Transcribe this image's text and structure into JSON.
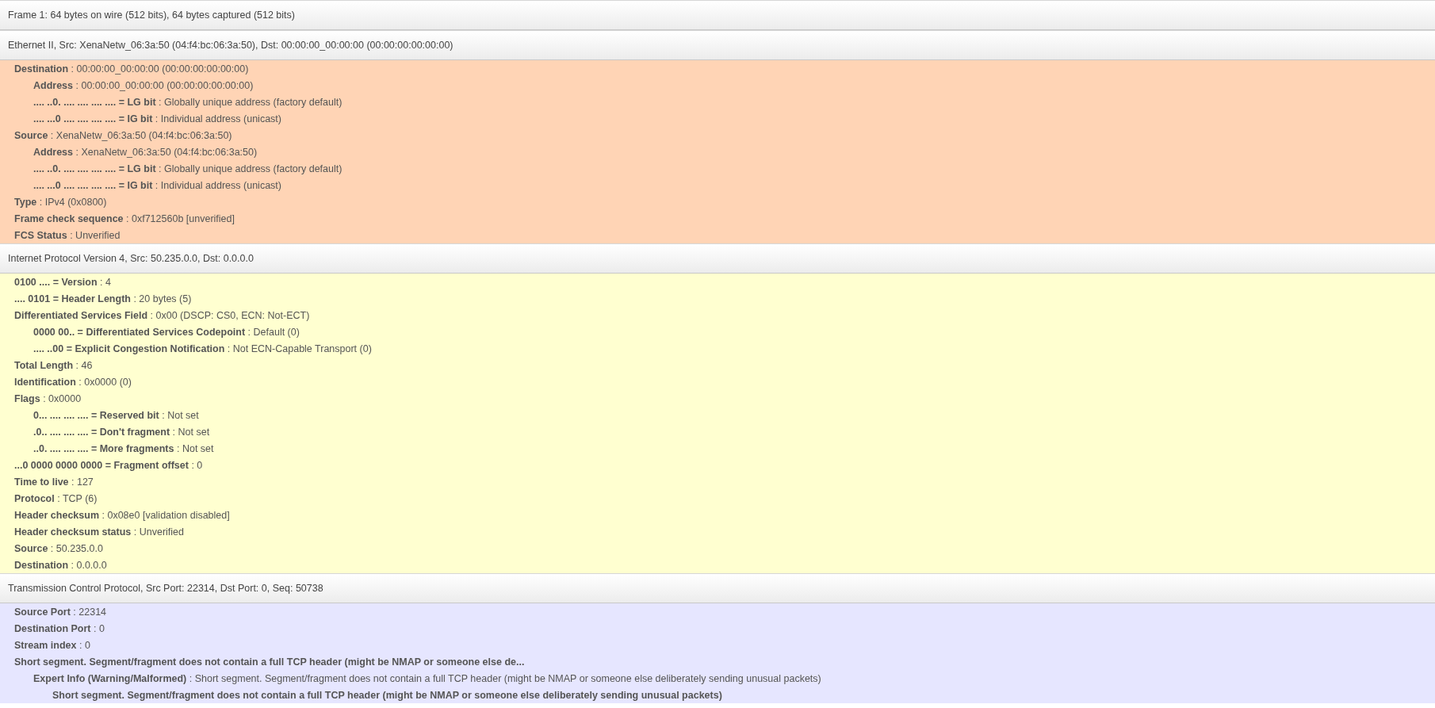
{
  "sections": [
    {
      "title": "Frame 1: 64 bytes on wire (512 bits), 64 bytes captured (512 bits)"
    },
    {
      "title": "Ethernet II, Src: XenaNetw_06:3a:50 (04:f4:bc:06:3a:50), Dst: 00:00:00_00:00:00 (00:00:00:00:00:00)",
      "color": "#ffd4b5",
      "fields": [
        {
          "kind": "field",
          "text": "**Destination** : 00:00:00_00:00:00 (00:00:00:00:00:00)",
          "children": [
            {
              "kind": "field",
              "text": "**Address** : 00:00:00_00:00:00 (00:00:00:00:00:00)"
            },
            {
              "kind": "field",
              "text": "**.... ..0. .... .... .... .... = LG bit** : Globally unique address (factory default)"
            },
            {
              "kind": "field",
              "text": "**.... ...0 .... .... .... .... = IG bit** : Individual address (unicast)"
            }
          ]
        },
        {
          "kind": "field",
          "text": "**Source** : XenaNetw_06:3a:50 (04:f4:bc:06:3a:50)",
          "children": [
            {
              "kind": "field",
              "text": "**Address** : XenaNetw_06:3a:50 (04:f4:bc:06:3a:50)"
            },
            {
              "kind": "field",
              "text": "**.... ..0. .... .... .... .... = LG bit** : Globally unique address (factory default)"
            },
            {
              "kind": "field",
              "text": "**.... ...0 .... .... .... .... = IG bit** : Individual address (unicast)"
            }
          ]
        },
        {
          "kind": "field",
          "text": "**Type** : IPv4 (0x0800)"
        },
        {
          "kind": "field",
          "text": "**Frame check sequence** : 0xf712560b [unverified]"
        },
        {
          "kind": "field",
          "text": "**FCS Status** : Unverified"
        }
      ]
    },
    {
      "title": "Internet Protocol Version 4, Src: 50.235.0.0, Dst: 0.0.0.0",
      "color": "#ffffd0",
      "fields": [
        {
          "kind": "field",
          "text": "**0100 .... = Version** : 4"
        },
        {
          "kind": "field",
          "text": "**.... 0101 = Header Length** : 20 bytes (5)"
        },
        {
          "kind": "field",
          "text": "**Differentiated Services Field** : 0x00 (DSCP: CS0, ECN: Not-ECT)",
          "children": [
            {
              "kind": "field",
              "text": "**0000 00.. = Differentiated Services Codepoint** : Default (0)"
            },
            {
              "kind": "field",
              "text": "**.... ..00 = Explicit Congestion Notification** : Not ECN-Capable Transport (0)"
            }
          ]
        },
        {
          "kind": "field",
          "text": "**Total Length** : 46"
        },
        {
          "kind": "field",
          "text": "**Identification** : 0x0000 (0)"
        },
        {
          "kind": "field",
          "text": "**Flags** : 0x0000",
          "children": [
            {
              "kind": "field",
              "text": "**0... .... .... .... = Reserved bit** : Not set"
            },
            {
              "kind": "field",
              "text": "**.0.. .... .... .... = Don't fragment** : Not set"
            },
            {
              "kind": "field",
              "text": "**..0. .... .... .... = More fragments** : Not set"
            }
          ]
        },
        {
          "kind": "field",
          "text": "**...0 0000 0000 0000 = Fragment offset** : 0"
        },
        {
          "kind": "field",
          "text": "**Time to live** : 127"
        },
        {
          "kind": "field",
          "text": "**Protocol** : TCP (6)"
        },
        {
          "kind": "field",
          "text": "**Header checksum** : 0x08e0 [validation disabled]"
        },
        {
          "kind": "field",
          "text": "**Header checksum status** : Unverified"
        },
        {
          "kind": "field",
          "text": "**Source** : 50.235.0.0"
        },
        {
          "kind": "field",
          "text": "**Destination** : 0.0.0.0"
        }
      ]
    },
    {
      "title": "Transmission Control Protocol, Src Port: 22314, Dst Port: 0, Seq: 50738",
      "color": "#e6e6ff",
      "fields": [
        {
          "kind": "field",
          "text": "**Source Port** : 22314"
        },
        {
          "kind": "field",
          "text": "**Destination Port** : 0"
        },
        {
          "kind": "field",
          "text": "**Stream index** : 0"
        },
        {
          "kind": "summary",
          "text": "Short segment. Segment/fragment does not contain a full TCP header (might be NMAP or someone else de...",
          "children": [
            {
              "kind": "field",
              "text": "**Expert Info (Warning/Malformed)** : Short segment. Segment/fragment does not contain a full TCP header (might be NMAP or someone else deliberately sending unusual packets)",
              "children": [
                {
                  "kind": "summary",
                  "text": "Short segment. Segment/fragment does not contain a full TCP header (might be NMAP or someone else deliberately sending unusual packets)"
                }
              ]
            }
          ]
        }
      ]
    }
  ]
}
